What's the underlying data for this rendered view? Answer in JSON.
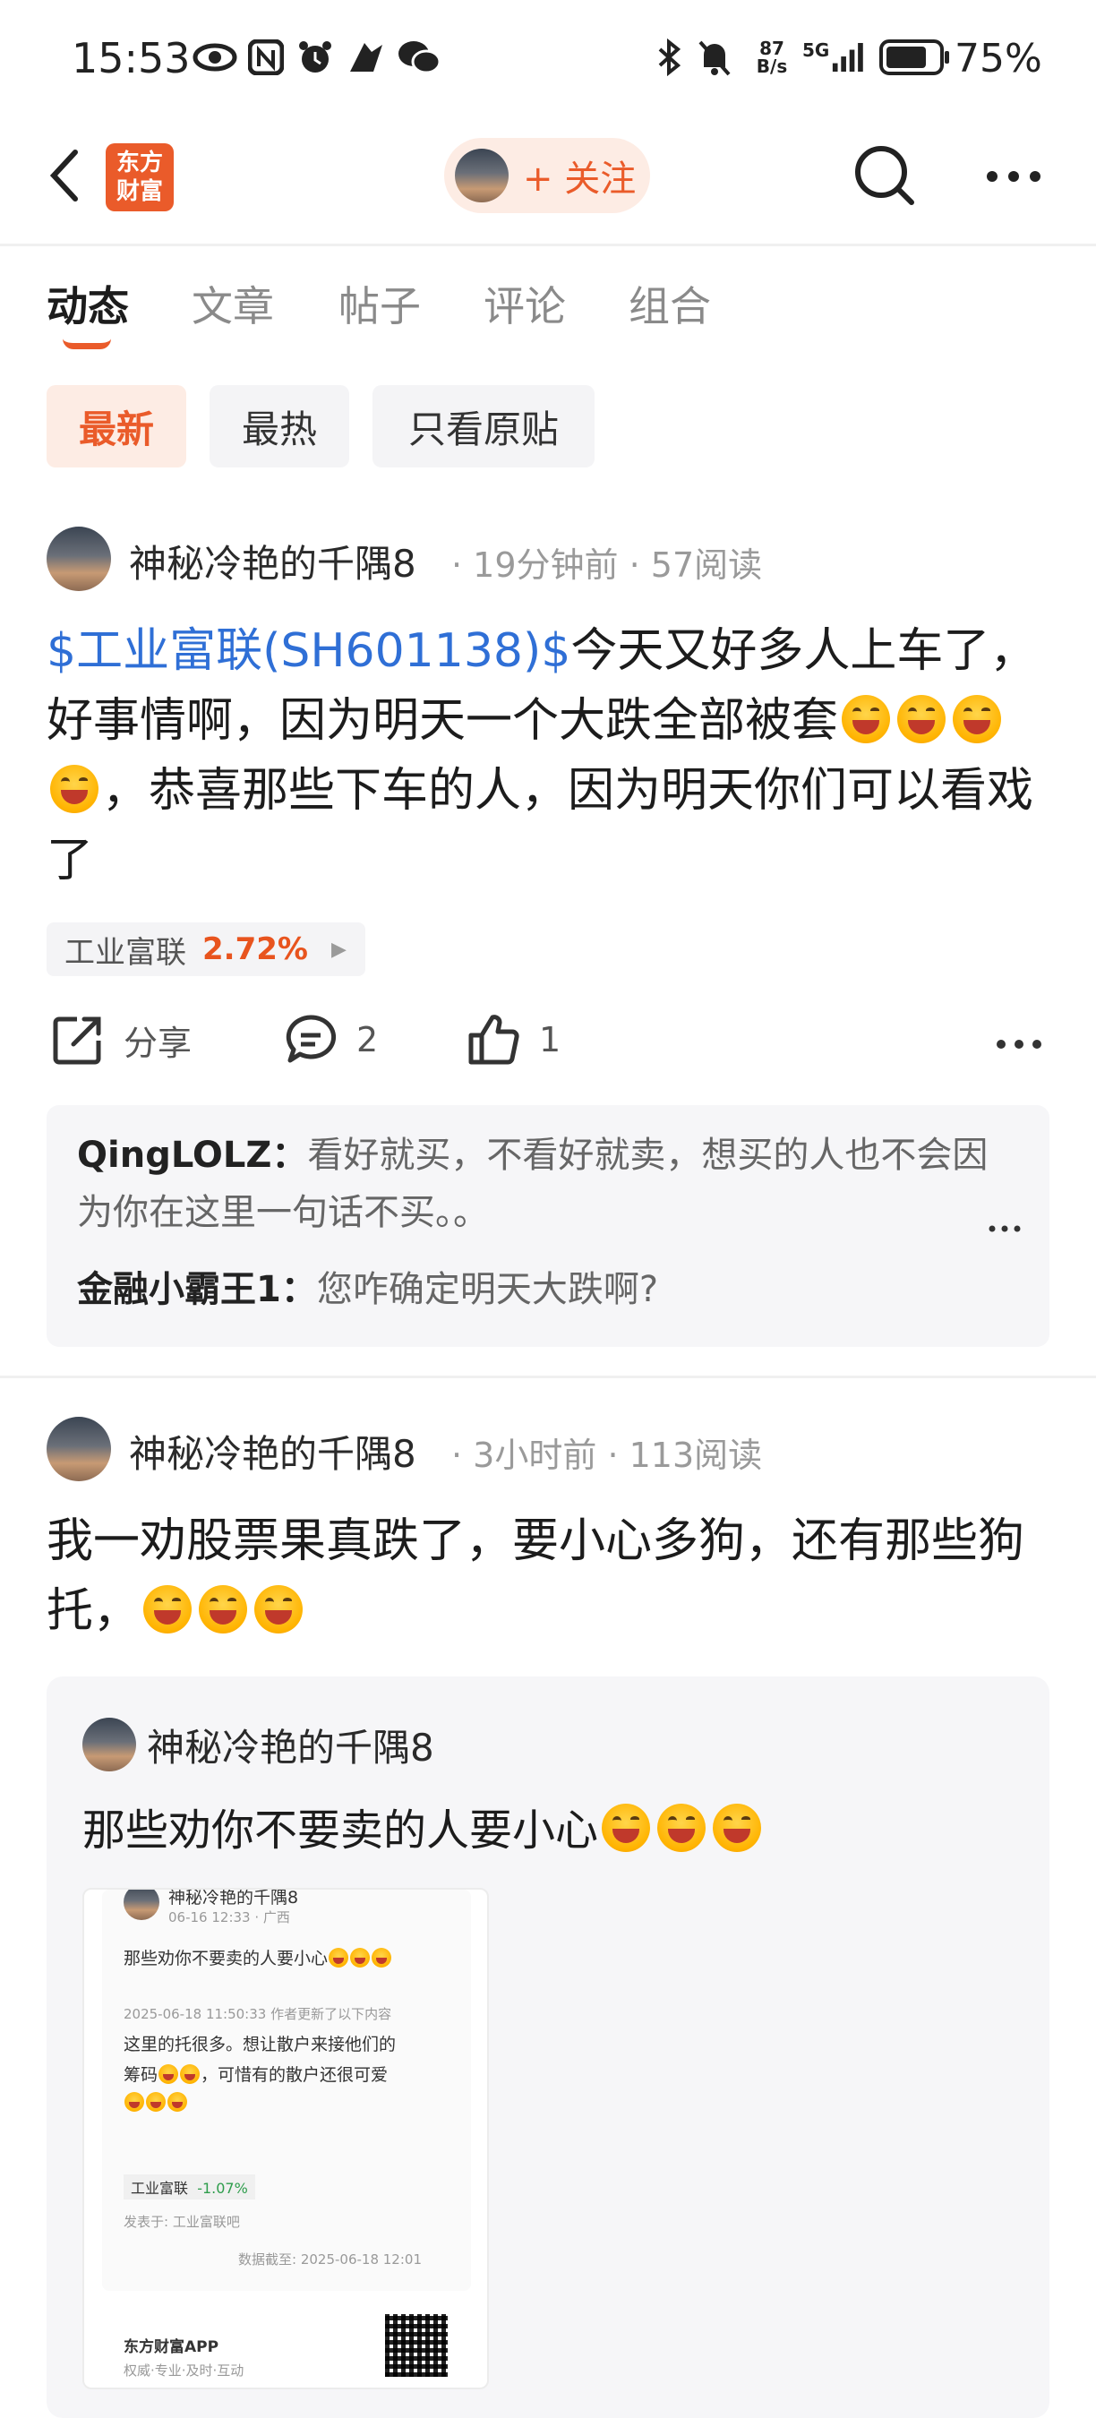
{
  "status_bar": {
    "time": "15:53",
    "net_speed_top": "87",
    "net_speed_bottom": "B/s",
    "network": "5G",
    "battery": "75%"
  },
  "header": {
    "logo_line1": "东方",
    "logo_line2": "财富",
    "follow_label": "+ 关注"
  },
  "tabs": [
    "动态",
    "文章",
    "帖子",
    "评论",
    "组合"
  ],
  "filters": [
    "最新",
    "最热",
    "只看原贴"
  ],
  "post1": {
    "author": "神秘冷艳的千隅8",
    "time": "19分钟前",
    "reads": "57阅读",
    "link_text": "$工业富联(SH601138)$",
    "text_a": "今天又好多人上车了，好事情啊，因为明天一个大跌全部被套",
    "text_b": "，恭喜那些下车的人，因为明天你们可以看戏了",
    "stock_name": "工业富联",
    "stock_pct": "2.72%",
    "share_label": "分享",
    "comment_count": "2",
    "like_count": "1",
    "comments": [
      {
        "user": "QingLOLZ",
        "text": "看好就买，不看好就卖，想买的人也不会因为你在这里一句话不买。。"
      },
      {
        "user": "金融小霸王1",
        "text": "您咋确定明天大跌啊?"
      }
    ]
  },
  "post2": {
    "author": "神秘冷艳的千隅8",
    "time": "3小时前",
    "reads": "113阅读",
    "text": "我一劝股票果真跌了，要小心多狗，还有那些狗托，",
    "quote": {
      "author": "神秘冷艳的千隅8",
      "text": "那些劝你不要卖的人要小心",
      "screenshot": {
        "author": "神秘冷艳的千隅8",
        "date_loc": "06-16 12:33 · 广西",
        "line1": "那些劝你不要卖的人要小心",
        "update_note": "2025-06-18 11:50:33 作者更新了以下内容",
        "line2": "这里的托很多。想让散户来接他们的",
        "line3": "筹码",
        "line3b": "，可惜有的散户还很可爱",
        "tag_name": "工业富联",
        "tag_pct": "-1.07%",
        "posted_in": "发表于: 工业富联吧",
        "data_cutoff": "数据截至: 2025-06-18 12:01",
        "app_name": "东方财富APP",
        "app_slogan": "权威·专业·及时·互动"
      }
    }
  }
}
